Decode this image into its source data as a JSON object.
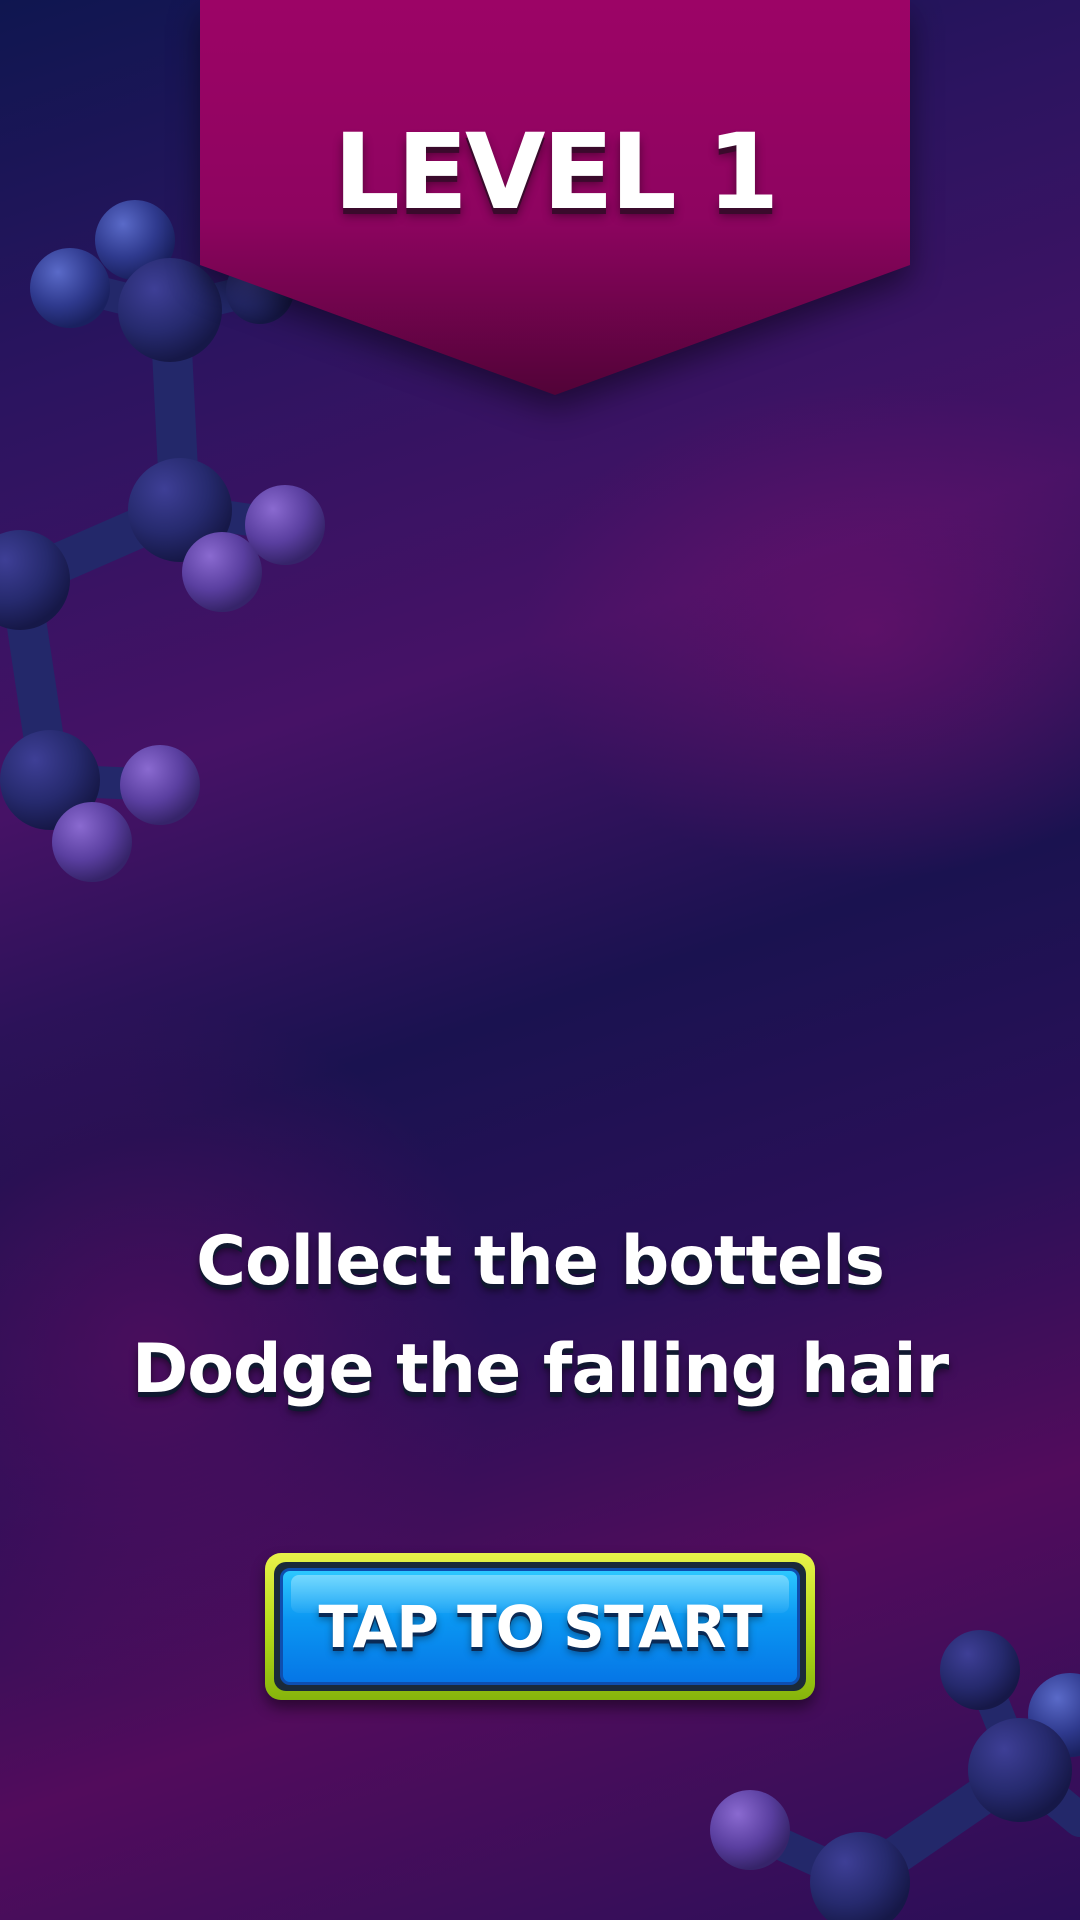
{
  "level": {
    "title": "LEVEL 1"
  },
  "instructions": {
    "line1": "Collect the bottels",
    "line2": "Dodge the falling hair"
  },
  "start_button": {
    "label": "TAP TO START"
  },
  "colors": {
    "banner": "#9c0466",
    "button_face": "#0a96f2",
    "button_frame": "#b7dc1a"
  },
  "decorations": {
    "top_left": "molecule-model",
    "bottom_right": "molecule-model"
  }
}
